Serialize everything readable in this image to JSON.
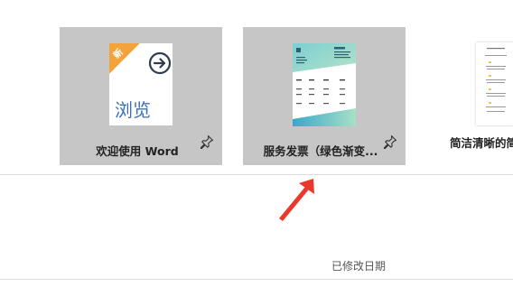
{
  "templates": [
    {
      "label": "欢迎使用 Word",
      "thumbnail": {
        "badge": "新",
        "main_text": "浏览",
        "icon": "arrow-right-circle-icon"
      },
      "pin_icon": "pin-icon"
    },
    {
      "label": "服务发票（绿色渐变...",
      "pin_icon": "pin-icon"
    },
    {
      "label": "简洁清晰的简"
    }
  ],
  "list_header": {
    "modified_label": "已修改日期"
  },
  "annotation": {
    "icon": "red-arrow-icon",
    "color": "#e8392b"
  },
  "colors": {
    "tile_bg": "#c6c6c6",
    "badge_orange": "#f3a33a",
    "word_blue": "#3d6fb6"
  }
}
